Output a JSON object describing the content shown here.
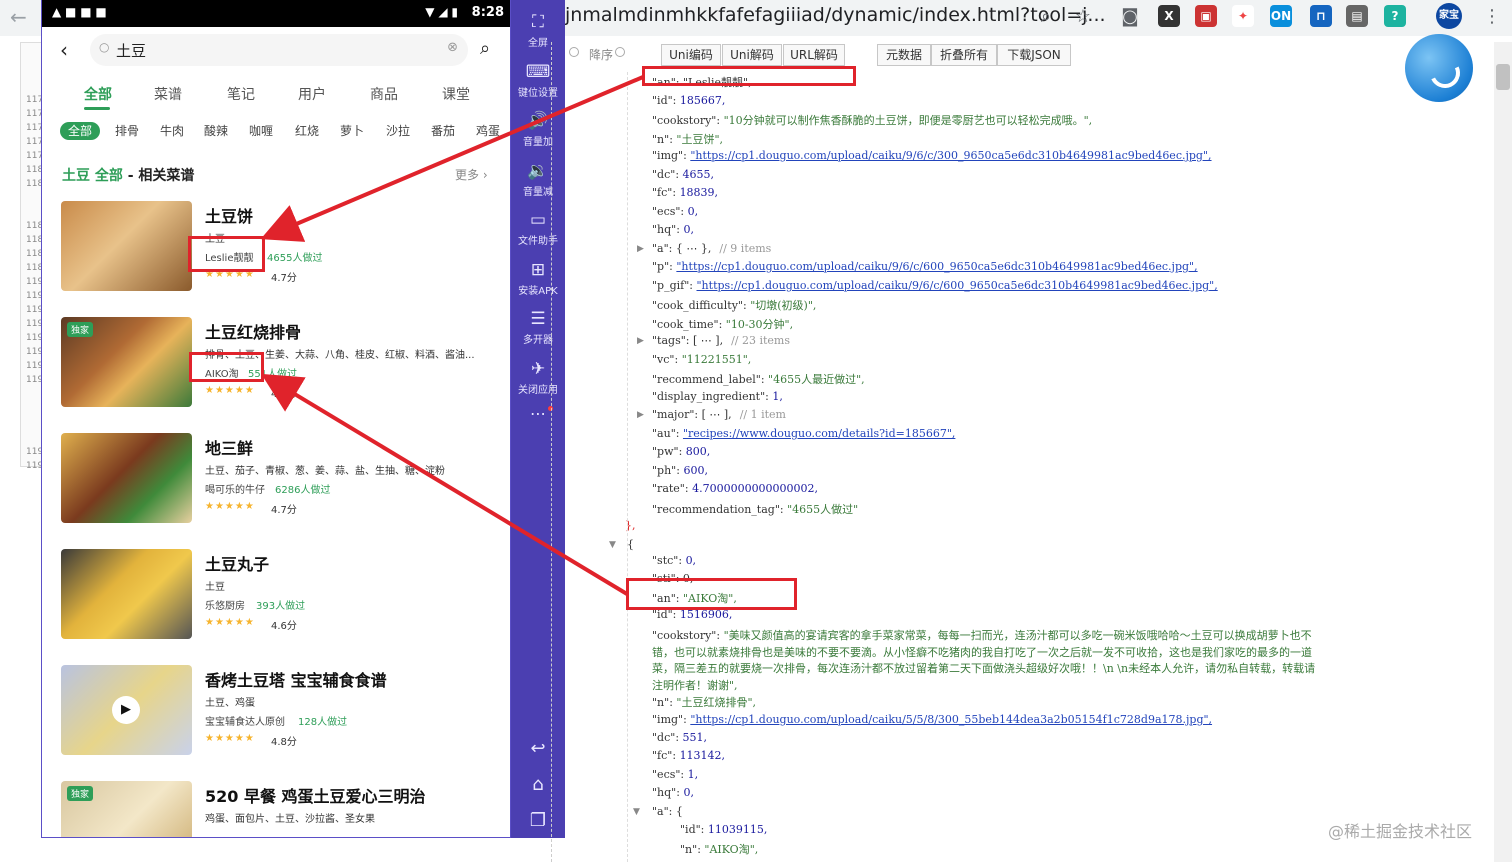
{
  "browser": {
    "url": "jnmalmdinmhkkfafefagiiiad/dynamic/index.html?tool=j..."
  },
  "phone": {
    "time": "8:28",
    "search_value": "土豆",
    "main_tabs": [
      {
        "label": "全部",
        "active": true
      },
      {
        "label": "菜谱"
      },
      {
        "label": "笔记"
      },
      {
        "label": "用户"
      },
      {
        "label": "商品"
      },
      {
        "label": "课堂"
      }
    ],
    "tags": [
      {
        "label": "全部",
        "active": true
      },
      {
        "label": "排骨"
      },
      {
        "label": "牛肉"
      },
      {
        "label": "酸辣"
      },
      {
        "label": "咖喱"
      },
      {
        "label": "红烧"
      },
      {
        "label": "萝卜"
      },
      {
        "label": "沙拉"
      },
      {
        "label": "番茄"
      },
      {
        "label": "鸡蛋"
      }
    ],
    "section": {
      "keyword": "土豆 全部",
      "suffix": " - 相关菜谱",
      "more": "更多"
    },
    "recipes": [
      {
        "title": "土豆饼",
        "ingredients": "土豆",
        "author": "Leslie靓靓",
        "made": "4655人做过",
        "stars": "★★★★★",
        "score": "4.7分",
        "badge": ""
      },
      {
        "title": "土豆红烧排骨",
        "ingredients": "排骨、土豆、生姜、大蒜、八角、桂皮、红椒、料酒、酱油...",
        "author": "AIKO淘",
        "made": "551人做过",
        "stars": "★★★★★",
        "score": "4.6分",
        "badge": "独家"
      },
      {
        "title": "地三鲜",
        "ingredients": "土豆、茄子、青椒、葱、姜、蒜、盐、生抽、糖、淀粉",
        "author": "喝可乐的牛仔",
        "made": "6286人做过",
        "stars": "★★★★★",
        "score": "4.7分",
        "badge": ""
      },
      {
        "title": "土豆丸子",
        "ingredients": "土豆",
        "author": "乐悠厨房",
        "made": "393人做过",
        "stars": "★★★★★",
        "score": "4.6分",
        "badge": ""
      },
      {
        "title": "香烤土豆塔  宝宝辅食食谱",
        "ingredients": "土豆、鸡蛋",
        "author": "宝宝辅食达人原创",
        "made": "128人做过",
        "stars": "★★★★★",
        "score": "4.8分",
        "badge": ""
      },
      {
        "title": "520 早餐 鸡蛋土豆爱心三明治",
        "ingredients": "鸡蛋、面包片、土豆、沙拉酱、圣女果",
        "author": "",
        "made": "",
        "stars": "",
        "score": "",
        "badge": "独家"
      }
    ]
  },
  "side_panel": [
    {
      "icon": "fullscreen-icon",
      "glyph": "⛶",
      "label": "全屏"
    },
    {
      "icon": "keyboard-icon",
      "glyph": "⌨",
      "label": "键位设置"
    },
    {
      "icon": "volume-up-icon",
      "glyph": "🔊",
      "label": "音量加"
    },
    {
      "icon": "volume-down-icon",
      "glyph": "🔉",
      "label": "音量减"
    },
    {
      "icon": "file-helper-icon",
      "glyph": "▭",
      "label": "文件助手"
    },
    {
      "icon": "install-apk-icon",
      "glyph": "⊞",
      "label": "安装APK"
    },
    {
      "icon": "multi-open-icon",
      "glyph": "☰",
      "label": "多开器"
    },
    {
      "icon": "close-app-icon",
      "glyph": "✈",
      "label": "关闭应用"
    }
  ],
  "json_toolbar": {
    "sort_label": "降序",
    "buttons_group1": [
      "Uni编码",
      "Uni解码",
      "URL解码"
    ],
    "buttons_group2": [
      "元数据",
      "折叠所有",
      "下载JSON"
    ]
  },
  "json_lines": {
    "l_an": "\"an\": \"Leslie靓靓\",",
    "l_id": "\"id\": ",
    "v_id": "185667,",
    "l_cookstory": "\"cookstory\": ",
    "v_cookstory": "\"10分钟就可以制作焦香酥脆的土豆饼，即便是零厨艺也可以轻松完成哦。\",",
    "l_n": "\"n\": ",
    "v_n": "\"土豆饼\",",
    "l_img": "\"img\": ",
    "v_img": "\"https://cp1.douguo.com/upload/caiku/9/6/c/300_9650ca5e6dc310b4649981ac9bed46ec.jpg\",",
    "l_dc": "\"dc\": ",
    "v_dc": "4655,",
    "l_fc": "\"fc\": ",
    "v_fc": "18839,",
    "l_ecs": "\"ecs\": ",
    "v_ecs": "0,",
    "l_hq": "\"hq\": ",
    "v_hq": "0,",
    "l_a": "\"a\": ",
    "v_a": "{ ⋯ },",
    "c_a": "// 9 items",
    "l_p": "\"p\": ",
    "v_p": "\"https://cp1.douguo.com/upload/caiku/9/6/c/600_9650ca5e6dc310b4649981ac9bed46ec.jpg\",",
    "l_pgif": "\"p_gif\": ",
    "v_pgif": "\"https://cp1.douguo.com/upload/caiku/9/6/c/600_9650ca5e6dc310b4649981ac9bed46ec.jpg\",",
    "l_cd": "\"cook_difficulty\": ",
    "v_cd": "\"切墩(初级)\",",
    "l_ct": "\"cook_time\": ",
    "v_ct": "\"10-30分钟\",",
    "l_tags": "\"tags\": ",
    "v_tags": "[ ⋯ ],",
    "c_tags": "// 23 items",
    "l_vc": "\"vc\": ",
    "v_vc": "\"11221551\",",
    "l_rl": "\"recommend_label\": ",
    "v_rl": "\"4655人最近做过\",",
    "l_di": "\"display_ingredient\": ",
    "v_di": "1,",
    "l_major": "\"major\": ",
    "v_major": "[ ⋯ ],",
    "c_major": "// 1 item",
    "l_au": "\"au\": ",
    "v_au": "\"recipes://www.douguo.com/details?id=185667\",",
    "l_pw": "\"pw\": ",
    "v_pw": "800,",
    "l_ph": "\"ph\": ",
    "v_ph": "600,",
    "l_rate": "\"rate\": ",
    "v_rate": "4.7000000000000002,",
    "l_rt": "\"recommendation_tag\": ",
    "v_rt": "\"4655人做过\"",
    "close1": "},",
    "open2": "{",
    "l_stc": "\"stc\": ",
    "v_stc": "0,",
    "l_sti": "\"sti\": 0,",
    "l_an2": "\"an\": ",
    "v_an2": "\"AIKO淘\",",
    "l_id2": "\"id\": ",
    "v_id2": "1516906,",
    "l_cs2": "\"cookstory\": ",
    "v_cs2_1": "\"美味又颜值高的宴请宾客的拿手菜家常菜，每每一扫而光，连汤汁都可以多吃一碗米饭哦哈哈～土豆可以换成胡萝卜也不",
    "v_cs2_2": "错，也可以就素烧排骨也是美味的不要不要滴。从小怪癖不吃猪肉的我自打吃了一次之后就一发不可收拾，这也是我们家吃的最多的一道",
    "v_cs2_3": "菜，隔三差五的就要烧一次排骨，每次连汤汁都不放过留着第二天下面做浇头超级好次哦！！\\n \\n未经本人允许，请勿私自转载，转载请",
    "v_cs2_4": "注明作者！谢谢\",",
    "l_n2": "\"n\": ",
    "v_n2": "\"土豆红烧排骨\",",
    "l_img2": "\"img\": ",
    "v_img2": "\"https://cp1.douguo.com/upload/caiku/5/5/8/300_55beb144dea3a2b05154f1c728d9a178.jpg\",",
    "l_dc2": "\"dc\": ",
    "v_dc2": "551,",
    "l_fc2": "\"fc\": ",
    "v_fc2": "113142,",
    "l_ecs2": "\"ecs\": ",
    "v_ecs2": "1,",
    "l_hq2": "\"hq\": ",
    "v_hq2": "0,",
    "l_a2": "\"a\": ",
    "v_a2": "{",
    "l_aid": "\"id\": ",
    "v_aid": "11039115,",
    "l_an3": "\"n\": ",
    "v_an3": "\"AIKO淘\","
  },
  "watermark": "@稀土掘金技术社区",
  "line_numbers": [
    "117",
    "117",
    "117",
    "117",
    "117",
    "118",
    "118",
    "118",
    "118",
    "118",
    "118",
    "119",
    "119",
    "119",
    "119",
    "119",
    "119",
    "119",
    "119",
    "119",
    "119"
  ],
  "annotation_color": "#e0232b",
  "accent_color": "#2e9e58",
  "panel_color": "#4b3fb1"
}
